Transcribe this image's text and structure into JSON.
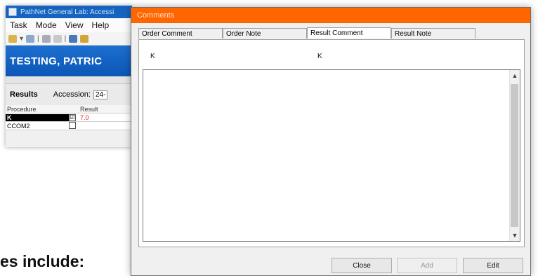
{
  "background_window": {
    "title": "PathNet General Lab: Accessi",
    "menu": [
      "Task",
      "Mode",
      "View",
      "Help"
    ],
    "patient_name": "TESTING, PATRIC",
    "results_label": "Results",
    "accession_label": "Accession:",
    "accession_value": "24-",
    "grid": {
      "headers": [
        "Procedure",
        "Result"
      ],
      "rows": [
        {
          "procedure": "K",
          "result": "7.0",
          "checked": "☑"
        },
        {
          "procedure": "CCOM2",
          "result": "",
          "checked": ""
        }
      ]
    }
  },
  "dialog": {
    "title": "Comments",
    "tabs": [
      "Order Comment",
      "Order Note",
      "Result Comment",
      "Result Note"
    ],
    "active_tab": "Result Comment",
    "procedure_left": "K",
    "procedure_right": "K",
    "comment_text": "",
    "buttons": {
      "close": "Close",
      "add": "Add",
      "edit": "Edit"
    }
  },
  "partial_text": "es include:",
  "colors": {
    "dialog_title_bar": "#ff6600",
    "banner": "#0b56b6",
    "result_value": "#e02020"
  }
}
